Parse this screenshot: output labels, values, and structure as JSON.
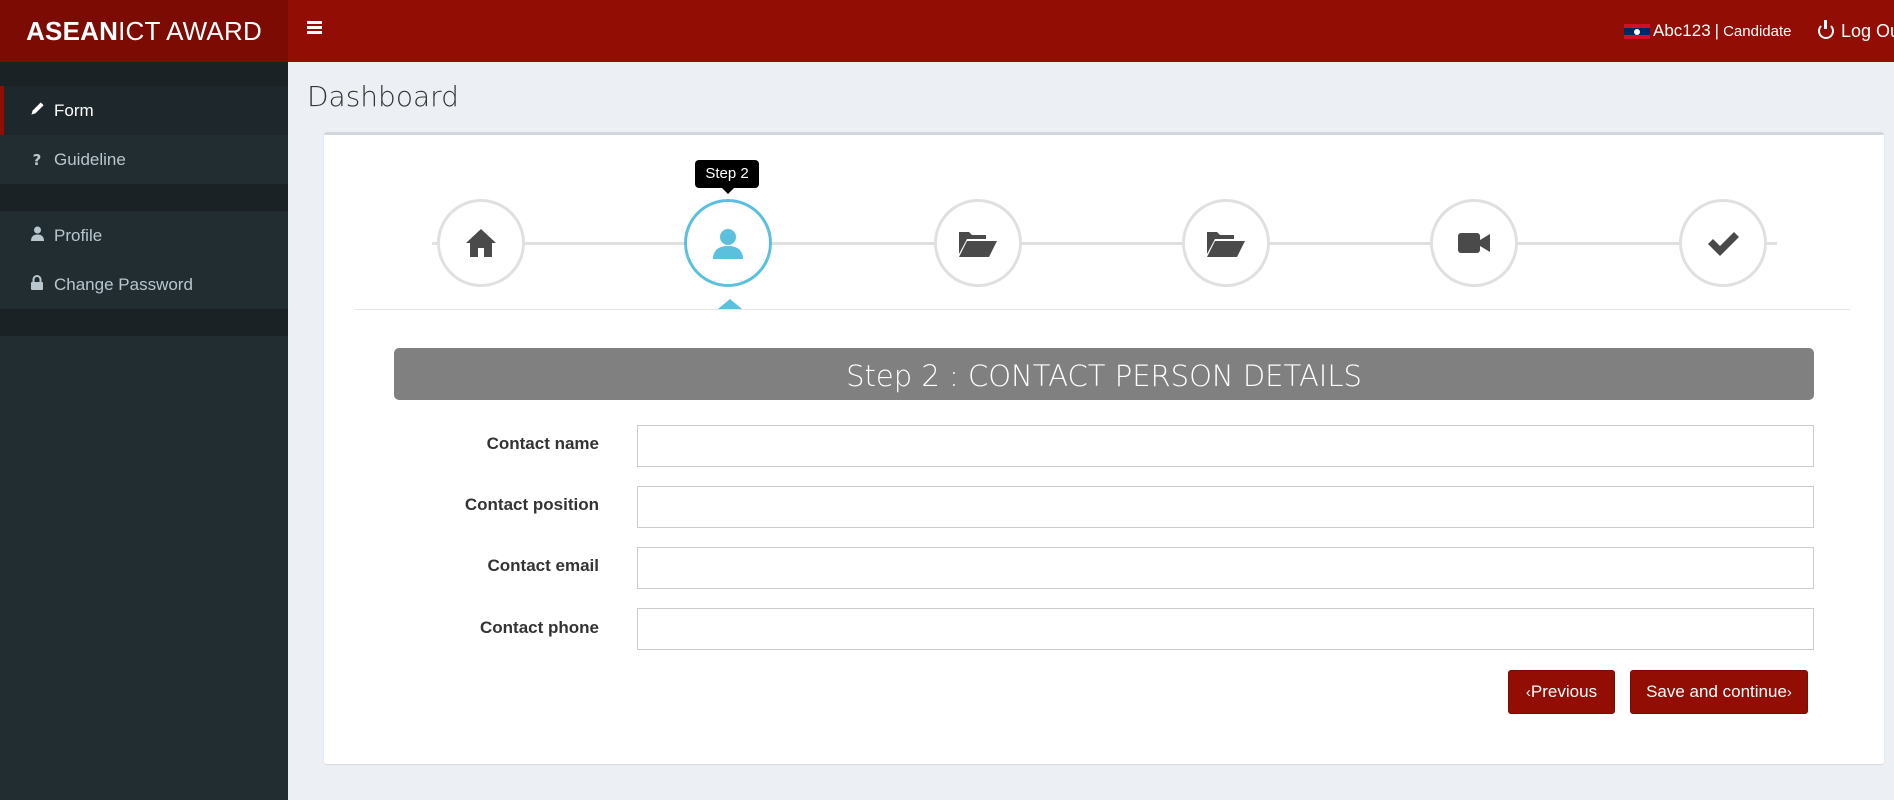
{
  "app": {
    "logo_bold": "ASEAN",
    "logo_rest": "ICT AWARD",
    "menu_icon": "hamburger-icon"
  },
  "user": {
    "flag_icon": "laos-flag-icon",
    "name": "Abc123",
    "separator": "|",
    "role": "Candidate",
    "logout_label": "Log Ou"
  },
  "sidebar": {
    "items": [
      {
        "label": "Form",
        "icon": "pencil-icon",
        "active": true
      },
      {
        "label": "Guideline",
        "icon": "question-icon",
        "active": false
      },
      {
        "label": "Profile",
        "icon": "user-icon",
        "active": false
      },
      {
        "label": "Change Password",
        "icon": "lock-icon",
        "active": false
      }
    ]
  },
  "page": {
    "title": "Dashboard"
  },
  "wizard": {
    "tooltip": "Step 2",
    "current_step": 2,
    "steps": [
      {
        "icon": "home-icon"
      },
      {
        "icon": "user-icon"
      },
      {
        "icon": "folder-open-icon"
      },
      {
        "icon": "folder-open-icon"
      },
      {
        "icon": "video-camera-icon"
      },
      {
        "icon": "check-icon"
      }
    ],
    "step_title": "Step 2 : CONTACT PERSON DETAILS"
  },
  "form": {
    "fields": [
      {
        "label": "Contact name",
        "value": "",
        "placeholder": ""
      },
      {
        "label": "Contact position",
        "value": "",
        "placeholder": ""
      },
      {
        "label": "Contact email",
        "value": "",
        "placeholder": ""
      },
      {
        "label": "Contact phone",
        "value": "",
        "placeholder": ""
      }
    ],
    "prev_label": "Previous",
    "next_label": "Save and continue"
  },
  "colors": {
    "brand": "#920d04",
    "brand_dark": "#7b0b03",
    "sidebar_bg": "#222d32",
    "active_step": "#5bc0de",
    "step_header_bg": "#808080",
    "content_bg": "#ecf0f5"
  }
}
